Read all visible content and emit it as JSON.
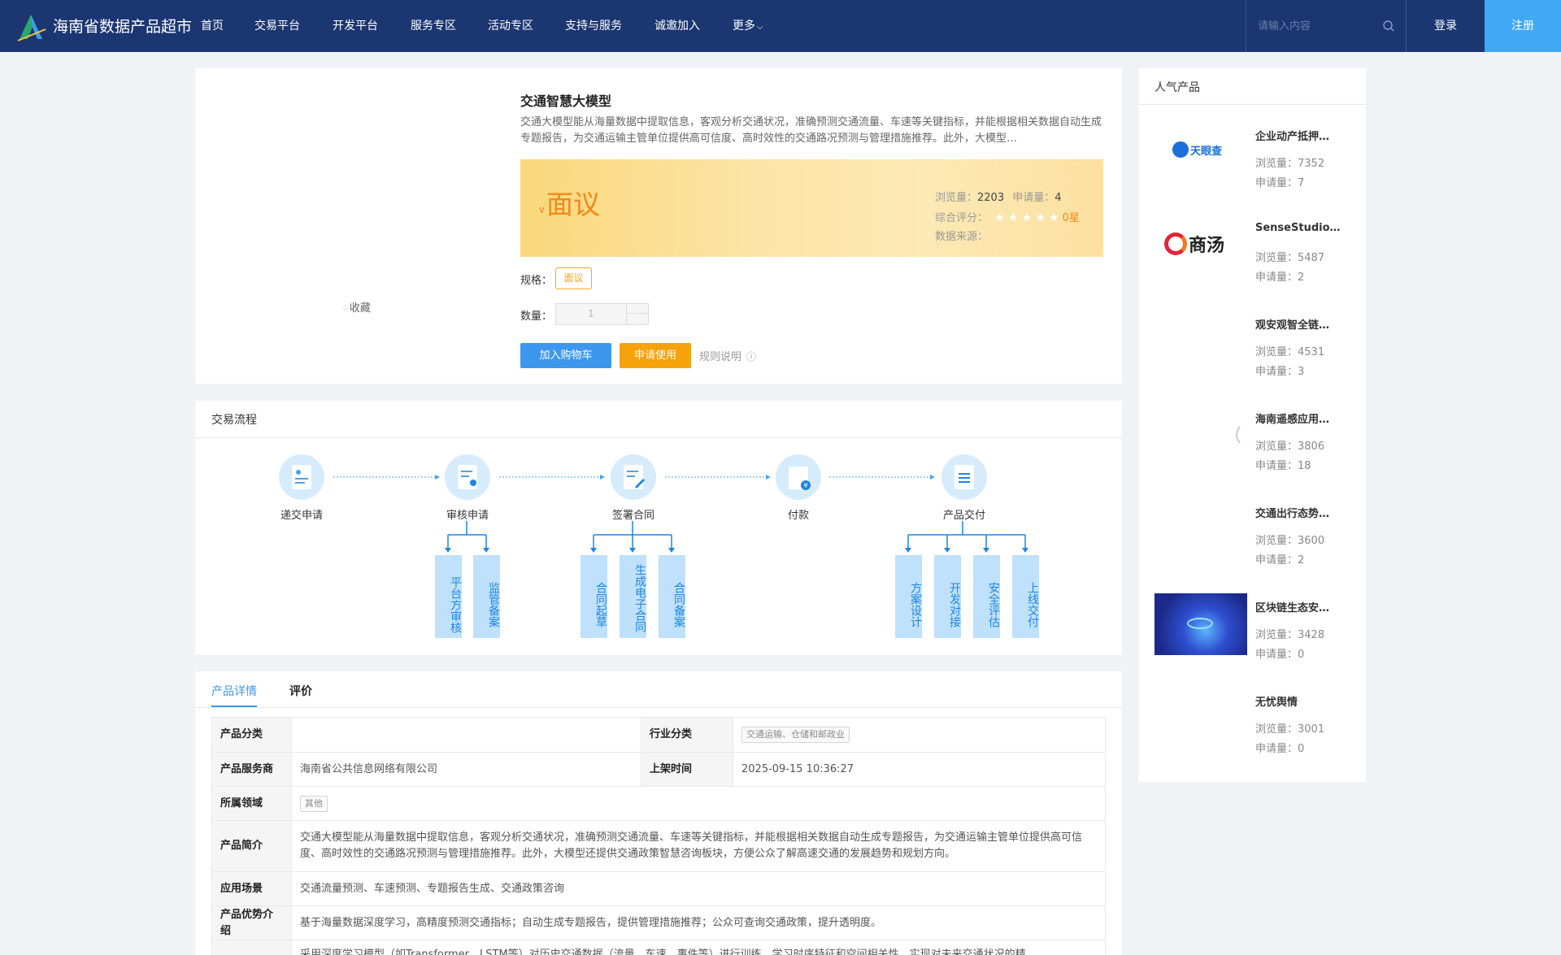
{
  "header": {
    "site_title": "海南省数据产品超市",
    "nav": [
      "首页",
      "交易平台",
      "开发平台",
      "服务专区",
      "活动专区",
      "支持与服务",
      "诚邀加入",
      "更多"
    ],
    "search_placeholder": "请输入内容",
    "login": "登录",
    "register": "注册"
  },
  "product": {
    "title": "交通智慧大模型",
    "description": "交通大模型能从海量数据中提取信息，客观分析交通状况，准确预测交通流量、车速等关键指标，并能根据相关数据自动生成专题报告，为交通运输主管单位提供高可信度、高时效性的交通路况预测与管理措施推荐。此外，大模型…",
    "price": "面议",
    "views_label": "浏览量：",
    "views": "2203",
    "applies_label": "申请量：",
    "applies": "4",
    "rating_label": "综合评分：",
    "rating_stars": 0,
    "rating_text": "0星",
    "source_label": "数据来源：",
    "spec_label": "规格：",
    "spec_value": "面议",
    "qty_label": "数量：",
    "qty_value": "1",
    "add_cart": "加入购物车",
    "apply": "申请使用",
    "rules": "规则说明",
    "favorite": "收藏"
  },
  "flow": {
    "title": "交易流程",
    "nodes": [
      "递交申请",
      "审核申请",
      "签署合同",
      "付款",
      "产品交付"
    ],
    "sub_steps": {
      "审核申请": [
        "平台方审核",
        "监管备案"
      ],
      "签署合同": [
        "合同起草",
        "生成电子合同",
        "合同备案"
      ],
      "产品交付": [
        "方案设计",
        "开发对接",
        "安全评估",
        "上线交付"
      ]
    }
  },
  "detail": {
    "tabs": [
      "产品详情",
      "评价"
    ],
    "rows": {
      "category_label": "产品分类",
      "category_value": "",
      "industry_label": "行业分类",
      "industry_value": "交通运输、仓储和邮政业",
      "provider_label": "产品服务商",
      "provider_value": "海南省公共信息网络有限公司",
      "listed_label": "上架时间",
      "listed_value": "2025-09-15 10:36:27",
      "domain_label": "所属领域",
      "domain_value": "其他",
      "intro_label": "产品简介",
      "intro_value": "交通大模型能从海量数据中提取信息，客观分析交通状况，准确预测交通流量、车速等关键指标，并能根据相关数据自动生成专题报告，为交通运输主管单位提供高可信度、高时效性的交通路况预测与管理措施推荐。此外，大模型还提供交通政策智慧咨询板块，方便公众了解高速交通的发展趋势和规划方向。",
      "scene_label": "应用场景",
      "scene_value": "交通流量预测、车速预测、专题报告生成、交通政策咨询",
      "advantage_label": "产品优势介绍",
      "advantage_value": "基于海量数据深度学习，高精度预测交通指标；自动生成专题报告，提供管理措施推荐；公众可查询交通政策，提升透明度。",
      "extra_value": "采用深度学习模型（如Transformer、LSTM等）对历史交通数据（流量、车速、事件等）进行训练，学习时序特征和空间相关性，实现对未来交通状况的精"
    }
  },
  "hot": {
    "title": "人气产品",
    "views_label": "浏览量：",
    "applies_label": "申请量：",
    "items": [
      {
        "name": "企业动产抵押…",
        "views": "7352",
        "applies": "7",
        "logo": "天眼查"
      },
      {
        "name": "SenseStudio…",
        "views": "5487",
        "applies": "2",
        "logo": "商汤"
      },
      {
        "name": "观安观智全链…",
        "views": "4531",
        "applies": "3",
        "logo": ""
      },
      {
        "name": "海南遥感应用…",
        "views": "3806",
        "applies": "18",
        "logo": ""
      },
      {
        "name": "交通出行态势…",
        "views": "3600",
        "applies": "2",
        "logo": ""
      },
      {
        "name": "区块链生态安…",
        "views": "3428",
        "applies": "0",
        "logo": ""
      },
      {
        "name": "无忧舆情",
        "views": "3001",
        "applies": "0",
        "logo": ""
      }
    ]
  },
  "colors": {
    "header": "#1c3672",
    "accent": "#3d97ee",
    "orange": "#f5a20c",
    "register": "#40a9f5"
  }
}
